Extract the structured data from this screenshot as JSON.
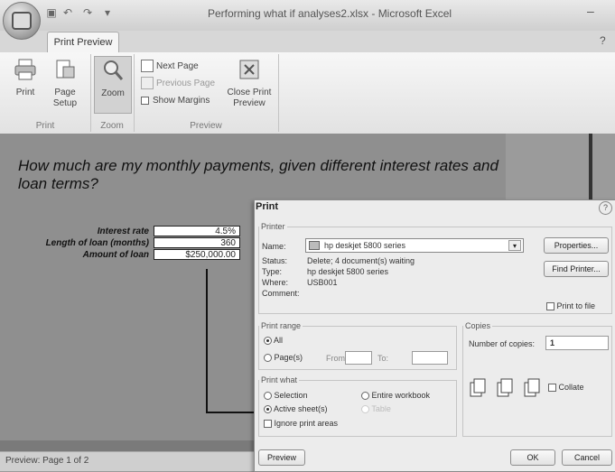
{
  "titlebar": {
    "window_title": "Performing what if analyses2.xlsx - Microsoft Excel",
    "minimize_glyph": "–"
  },
  "tabs": {
    "print_preview": "Print Preview",
    "help_glyph": "?"
  },
  "ribbon": {
    "print_label": "Print",
    "page_setup_label_1": "Page",
    "page_setup_label_2": "Setup",
    "zoom_label": "Zoom",
    "next_page_label": "Next Page",
    "previous_page_label": "Previous Page",
    "show_margins_label": "Show Margins",
    "close_label_1": "Close Print",
    "close_label_2": "Preview",
    "group_print": "Print",
    "group_zoom": "Zoom",
    "group_preview": "Preview"
  },
  "sheet": {
    "heading": "How much are my monthly payments, given different interest rates and loan terms?",
    "rows": [
      {
        "label": "Interest rate",
        "value": "4.5%"
      },
      {
        "label": "Length of loan (months)",
        "value": "360"
      },
      {
        "label": "Amount of loan",
        "value": "$250,000.00"
      }
    ]
  },
  "status": {
    "text": "Preview: Page 1 of 2"
  },
  "dialog": {
    "title": "Print",
    "help_glyph": "?",
    "printer_group": "Printer",
    "name_label": "Name:",
    "printer_name": "hp deskjet 5800 series",
    "status_label": "Status:",
    "status_value": "Delete; 4 document(s) waiting",
    "type_label": "Type:",
    "type_value": "hp deskjet 5800 series",
    "where_label": "Where:",
    "where_value": "USB001",
    "comment_label": "Comment:",
    "properties_btn": "Properties...",
    "find_printer_btn": "Find Printer...",
    "print_to_file": "Print to file",
    "range_group": "Print range",
    "all_label": "All",
    "pages_label": "Page(s)",
    "from_label": "From:",
    "to_label": "To:",
    "copies_group": "Copies",
    "number_of_copies": "Number of copies:",
    "copies_value": "1",
    "collate": "Collate",
    "what_group": "Print what",
    "selection": "Selection",
    "entire_workbook": "Entire workbook",
    "active_sheets": "Active sheet(s)",
    "table": "Table",
    "ignore_print_areas": "Ignore print areas",
    "preview_btn": "Preview",
    "ok_btn": "OK",
    "cancel_btn": "Cancel"
  }
}
